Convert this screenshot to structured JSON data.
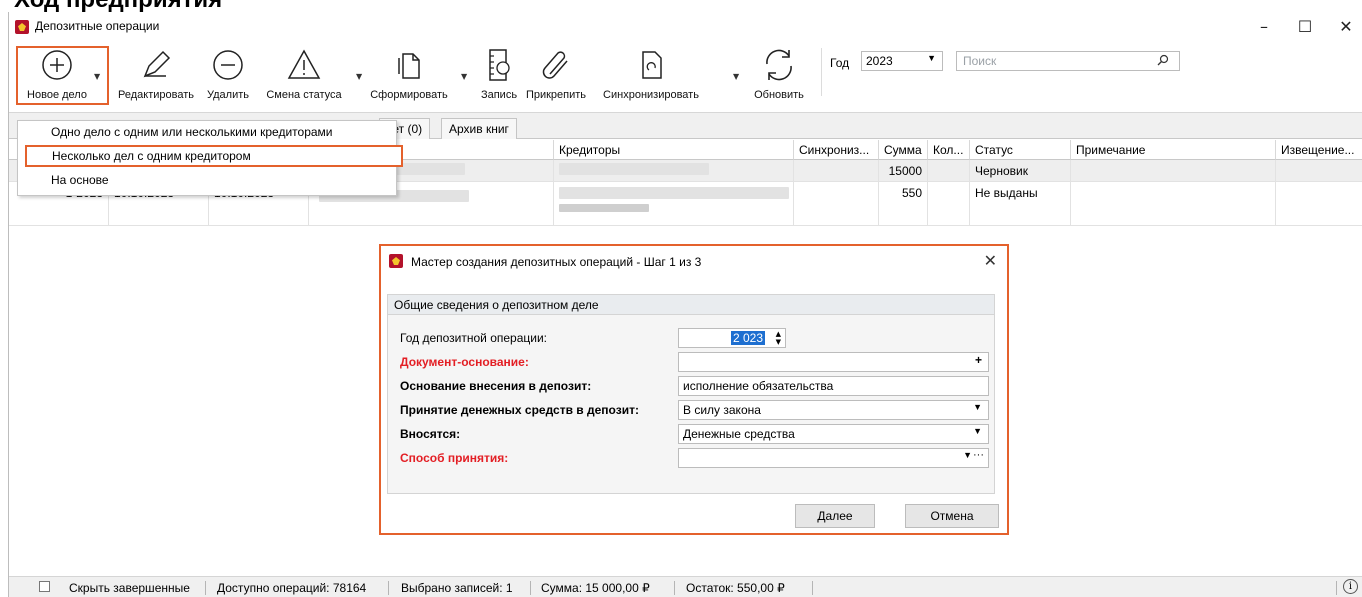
{
  "window": {
    "title": "Депозитные операции",
    "minimize": "–",
    "maximize": "☐",
    "close": "✕"
  },
  "toolbar": {
    "new": "Новое дело",
    "edit": "Редактировать",
    "delete": "Удалить",
    "status": "Смена статуса",
    "form": "Сформировать",
    "record": "Запись",
    "attach": "Прикрепить",
    "sync": "Синхронизировать",
    "refresh": "Обновить",
    "year_label": "Год",
    "year_value": "2023",
    "search_placeholder": "Поиск"
  },
  "new_menu": {
    "items": [
      "Одно дело с одним или несколькими кредиторами",
      "Несколько дел с одним кредитором",
      "На основе"
    ]
  },
  "tabs": [
    "кет (0)",
    "Архив книг"
  ],
  "grid": {
    "headers": [
      "Кредиторы",
      "Синхрониз...",
      "Сумма",
      "Кол...",
      "Статус",
      "Примечание",
      "Извещение..."
    ],
    "rows": [
      {
        "num": "",
        "date1": "",
        "date2": "",
        "sum": "15000",
        "status": "Черновик"
      },
      {
        "num": "1-2023",
        "date1": "10.10.2023",
        "date2": "10.10.2023",
        "sum": "550",
        "status": "Не выданы"
      }
    ]
  },
  "dialog": {
    "title": "Мастер создания депозитных операций - Шаг 1 из 3",
    "group": "Общие сведения о депозитном деле",
    "fields": {
      "year_label": "Год депозитной операции:",
      "year_value": "2 023",
      "doc_label": "Документ-основание:",
      "doc_plus": "+",
      "basis_label": "Основание внесения в депозит:",
      "basis_value": "исполнение обязательства",
      "accept_label": "Принятие денежных средств в депозит:",
      "accept_value": "В силу закона",
      "deposit_label": "Вносятся:",
      "deposit_value": "Денежные средства",
      "method_label": "Способ принятия:",
      "method_value": ""
    },
    "next": "Далее",
    "cancel": "Отмена"
  },
  "status": {
    "hide": "Скрыть завершенные",
    "available": "Доступно операций: 78164",
    "selected": "Выбрано записей: 1",
    "sum": "Сумма: 15 000,00 ₽",
    "rest": "Остаток: 550,00 ₽"
  },
  "colors": {
    "accent": "#e4612c",
    "required": "#e31e24",
    "selection": "#1e6fd0"
  }
}
